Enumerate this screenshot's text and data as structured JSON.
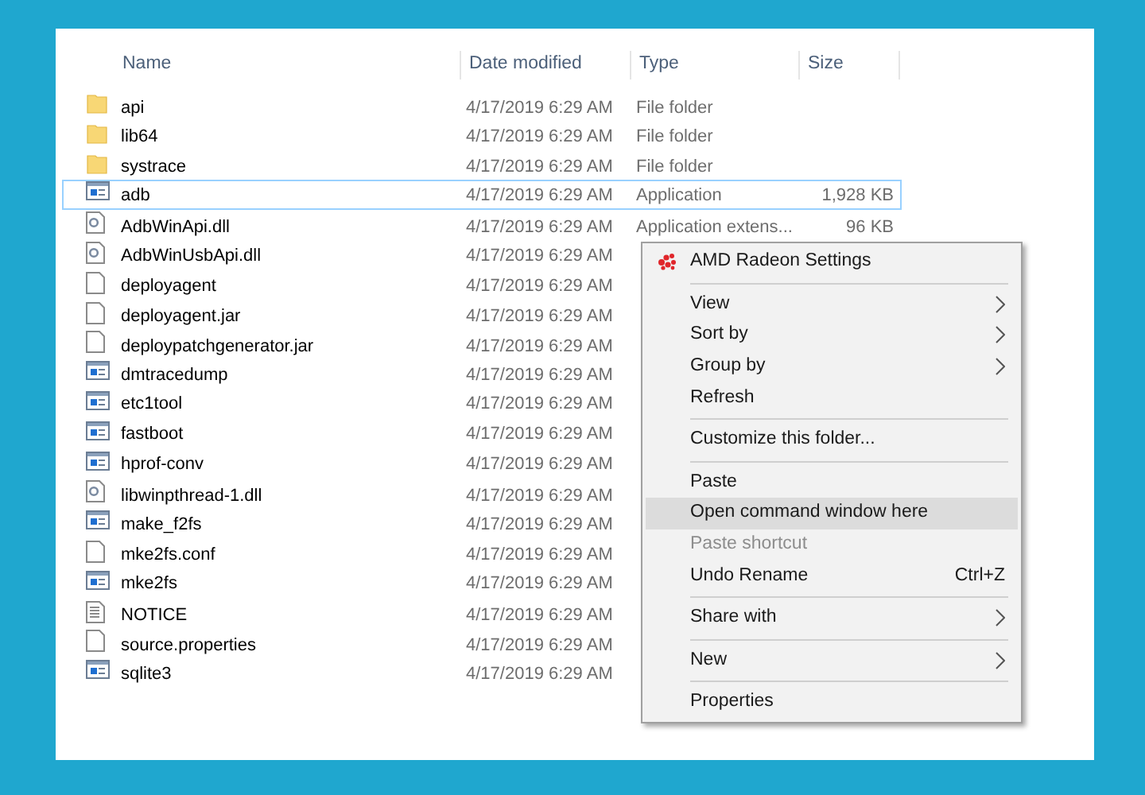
{
  "columns": [
    "Name",
    "Date modified",
    "Type",
    "Size"
  ],
  "files": [
    {
      "name": "api",
      "kind": "folder",
      "date": "4/17/2019 6:29 AM",
      "type": "File folder",
      "selected": false
    },
    {
      "name": "lib64",
      "kind": "folder",
      "date": "4/17/2019 6:29 AM",
      "type": "File folder",
      "selected": false
    },
    {
      "name": "systrace",
      "kind": "folder",
      "date": "4/17/2019 6:29 AM",
      "type": "File folder",
      "selected": false
    },
    {
      "name": "adb",
      "kind": "app",
      "date": "4/17/2019 6:29 AM",
      "type": "Application",
      "size": "1,928 KB",
      "selected": true
    },
    {
      "name": "AdbWinApi.dll",
      "kind": "dll",
      "date": "4/17/2019 6:29 AM",
      "type": "Application extens...",
      "size": "96 KB",
      "selected": false
    },
    {
      "name": "AdbWinUsbApi.dll",
      "kind": "dll",
      "date": "4/17/2019 6:29 AM",
      "selected": false
    },
    {
      "name": "deployagent",
      "kind": "file",
      "date": "4/17/2019 6:29 AM",
      "selected": false
    },
    {
      "name": "deployagent.jar",
      "kind": "file",
      "date": "4/17/2019 6:29 AM",
      "selected": false
    },
    {
      "name": "deploypatchgenerator.jar",
      "kind": "file",
      "date": "4/17/2019 6:29 AM",
      "selected": false
    },
    {
      "name": "dmtracedump",
      "kind": "app",
      "date": "4/17/2019 6:29 AM",
      "selected": false
    },
    {
      "name": "etc1tool",
      "kind": "app",
      "date": "4/17/2019 6:29 AM",
      "selected": false
    },
    {
      "name": "fastboot",
      "kind": "app",
      "date": "4/17/2019 6:29 AM",
      "selected": false
    },
    {
      "name": "hprof-conv",
      "kind": "app",
      "date": "4/17/2019 6:29 AM",
      "selected": false
    },
    {
      "name": "libwinpthread-1.dll",
      "kind": "dll",
      "date": "4/17/2019 6:29 AM",
      "selected": false
    },
    {
      "name": "make_f2fs",
      "kind": "app",
      "date": "4/17/2019 6:29 AM",
      "selected": false
    },
    {
      "name": "mke2fs.conf",
      "kind": "file",
      "date": "4/17/2019 6:29 AM",
      "selected": false
    },
    {
      "name": "mke2fs",
      "kind": "app",
      "date": "4/17/2019 6:29 AM",
      "selected": false
    },
    {
      "name": "NOTICE",
      "kind": "text",
      "date": "4/17/2019 6:29 AM",
      "selected": false
    },
    {
      "name": "source.properties",
      "kind": "file",
      "date": "4/17/2019 6:29 AM",
      "selected": false
    },
    {
      "name": "sqlite3",
      "kind": "app",
      "date": "4/17/2019 6:29 AM",
      "selected": false
    }
  ],
  "context_menu": [
    {
      "kind": "item",
      "label": "AMD Radeon Settings",
      "icon": true,
      "submenu": false,
      "selected": false,
      "disabled": false
    },
    {
      "kind": "separator"
    },
    {
      "kind": "item",
      "label": "View",
      "submenu": true,
      "selected": false,
      "disabled": false
    },
    {
      "kind": "item",
      "label": "Sort by",
      "submenu": true,
      "selected": false,
      "disabled": false
    },
    {
      "kind": "item",
      "label": "Group by",
      "submenu": true,
      "selected": false,
      "disabled": false
    },
    {
      "kind": "item",
      "label": "Refresh",
      "submenu": false,
      "selected": false,
      "disabled": false
    },
    {
      "kind": "separator"
    },
    {
      "kind": "item",
      "label": "Customize this folder...",
      "submenu": false,
      "selected": false,
      "disabled": false
    },
    {
      "kind": "separator"
    },
    {
      "kind": "item",
      "label": "Paste",
      "submenu": false,
      "selected": false,
      "disabled": false
    },
    {
      "kind": "item",
      "label": "Open command window here",
      "submenu": false,
      "selected": true,
      "disabled": false
    },
    {
      "kind": "item",
      "label": "Paste shortcut",
      "submenu": false,
      "selected": false,
      "disabled": true
    },
    {
      "kind": "item",
      "label": "Undo Rename",
      "shortcut": "Ctrl+Z",
      "submenu": false,
      "selected": false,
      "disabled": false
    },
    {
      "kind": "separator"
    },
    {
      "kind": "item",
      "label": "Share with",
      "submenu": true,
      "selected": false,
      "disabled": false
    },
    {
      "kind": "separator"
    },
    {
      "kind": "item",
      "label": "New",
      "submenu": true,
      "selected": false,
      "disabled": false
    },
    {
      "kind": "separator"
    },
    {
      "kind": "item",
      "label": "Properties",
      "submenu": false,
      "selected": false,
      "disabled": false
    }
  ]
}
